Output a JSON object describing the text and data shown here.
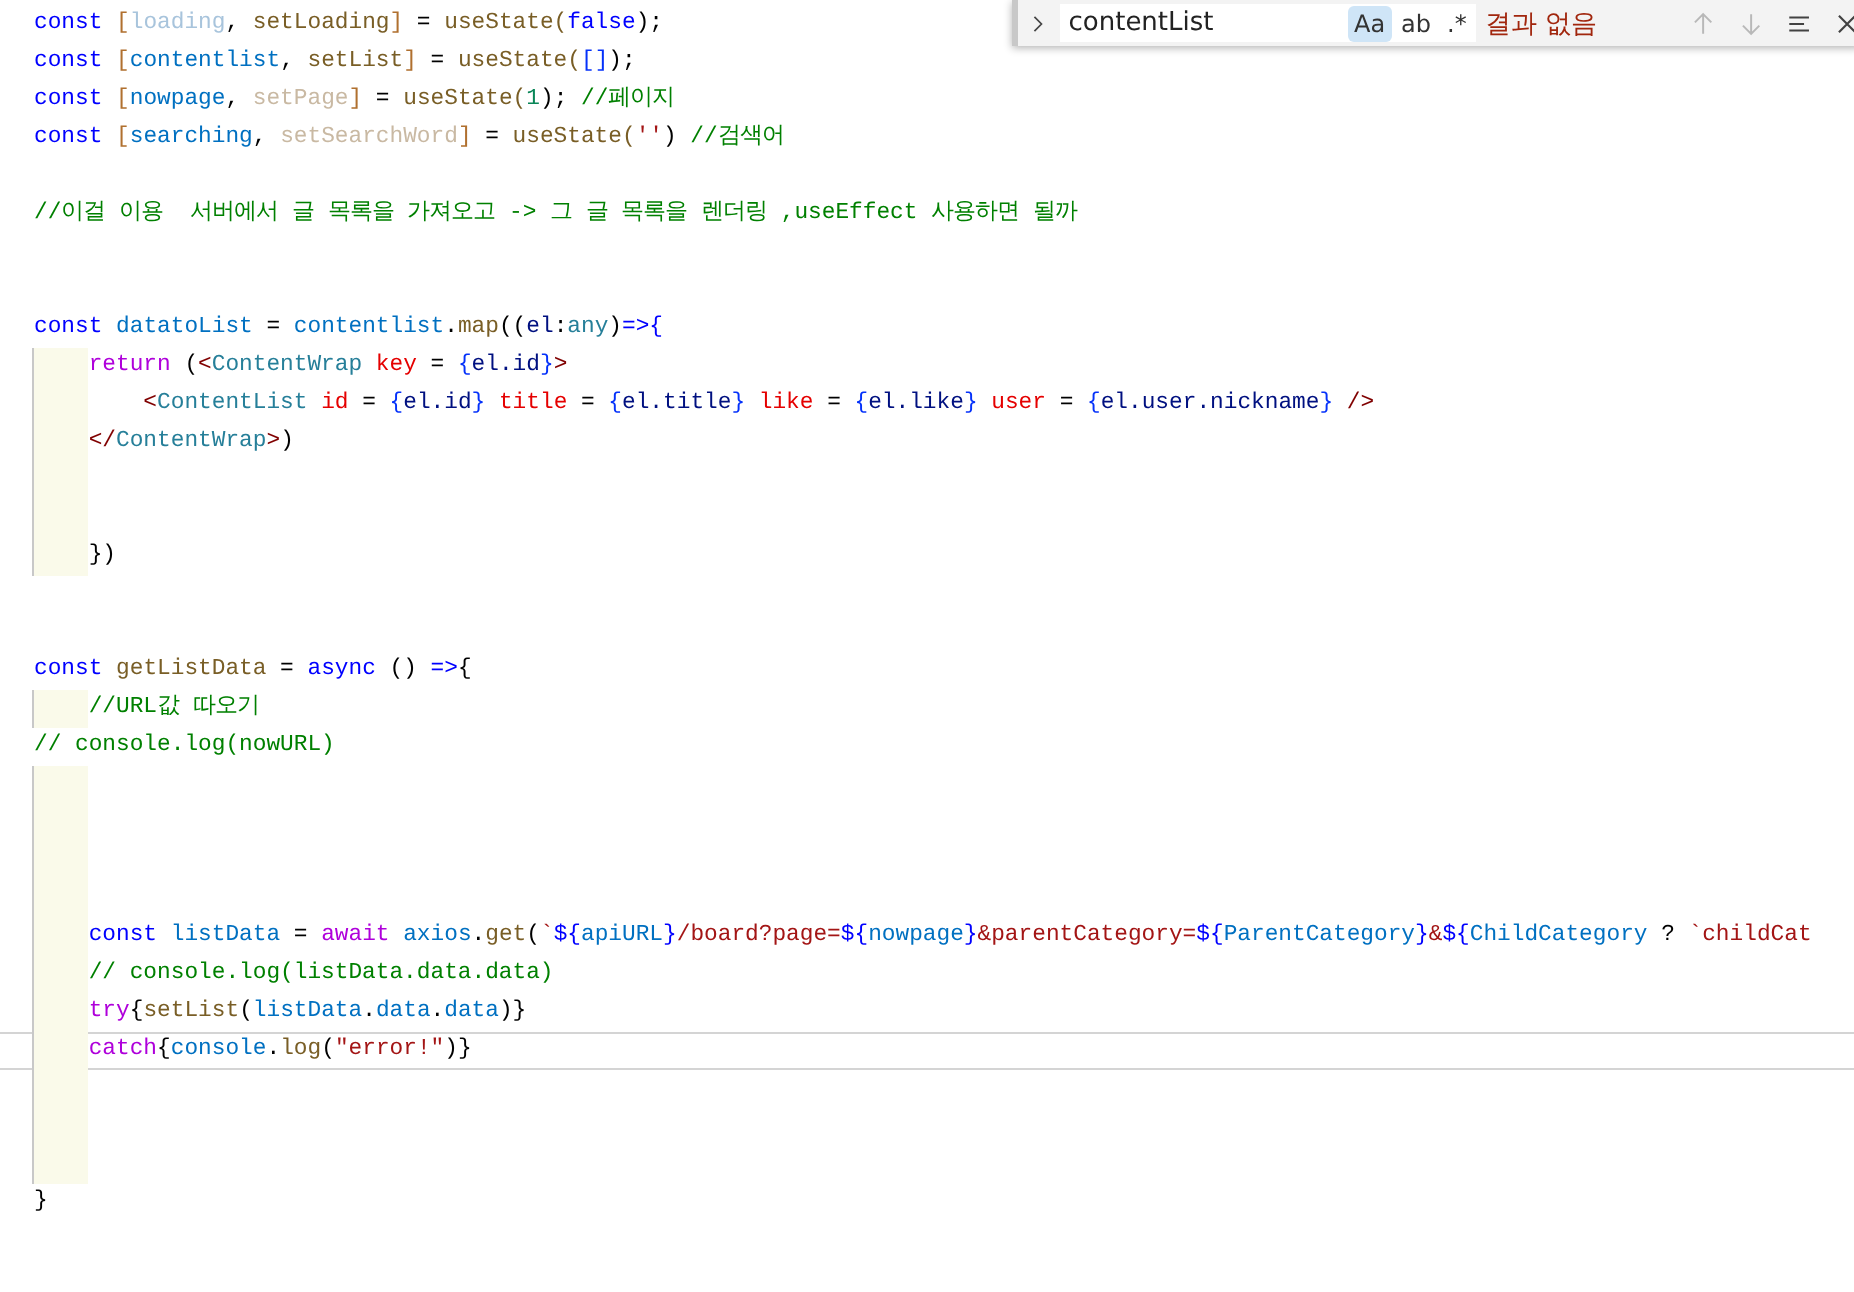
{
  "editor": {
    "lines": [
      {
        "current": false,
        "indented": false,
        "tokens": [
          {
            "text": "const",
            "kind": "keyword"
          },
          {
            "text": " [",
            "kind": "bracket"
          },
          {
            "text": "loading",
            "kind": "unused"
          },
          {
            "text": ", ",
            "kind": "plain"
          },
          {
            "text": "setLoading",
            "kind": "function"
          },
          {
            "text": "]",
            "kind": "bracket"
          },
          {
            "text": " = ",
            "kind": "plain"
          },
          {
            "text": "useState(",
            "kind": "function"
          },
          {
            "text": "false",
            "kind": "keyword"
          },
          {
            "text": ");",
            "kind": "plain"
          }
        ]
      },
      {
        "current": false,
        "indented": false,
        "tokens": [
          {
            "text": "const",
            "kind": "keyword"
          },
          {
            "text": " [",
            "kind": "bracket"
          },
          {
            "text": "contentlist",
            "kind": "variable"
          },
          {
            "text": ", ",
            "kind": "plain"
          },
          {
            "text": "setList",
            "kind": "function"
          },
          {
            "text": "]",
            "kind": "bracket"
          },
          {
            "text": " = ",
            "kind": "plain"
          },
          {
            "text": "useState(",
            "kind": "function"
          },
          {
            "text": "[]",
            "kind": "brace"
          },
          {
            "text": ");",
            "kind": "plain"
          }
        ]
      },
      {
        "current": false,
        "indented": false,
        "tokens": [
          {
            "text": "const",
            "kind": "keyword"
          },
          {
            "text": " [",
            "kind": "bracket"
          },
          {
            "text": "nowpage",
            "kind": "variable"
          },
          {
            "text": ", ",
            "kind": "plain"
          },
          {
            "text": "setPage",
            "kind": "unusedfn"
          },
          {
            "text": "]",
            "kind": "bracket"
          },
          {
            "text": " = ",
            "kind": "plain"
          },
          {
            "text": "useState(",
            "kind": "function"
          },
          {
            "text": "1",
            "kind": "number"
          },
          {
            "text": "); ",
            "kind": "plain"
          },
          {
            "text": "//페이지",
            "kind": "comment"
          }
        ]
      },
      {
        "current": false,
        "indented": false,
        "tokens": [
          {
            "text": "const",
            "kind": "keyword"
          },
          {
            "text": " [",
            "kind": "bracket"
          },
          {
            "text": "searching",
            "kind": "variable"
          },
          {
            "text": ", ",
            "kind": "plain"
          },
          {
            "text": "setSearchWord",
            "kind": "unusedfn"
          },
          {
            "text": "]",
            "kind": "bracket"
          },
          {
            "text": " = ",
            "kind": "plain"
          },
          {
            "text": "useState(",
            "kind": "function"
          },
          {
            "text": "''",
            "kind": "string"
          },
          {
            "text": ") ",
            "kind": "plain"
          },
          {
            "text": "//검색어",
            "kind": "comment"
          }
        ]
      },
      {
        "current": false,
        "indented": false
      },
      {
        "current": false,
        "indented": false,
        "tokens": [
          {
            "text": "//이걸 이용  서버에서 글 목록을 가져오고 -> 그 글 목록을 렌더링 ,useEffect 사용하면 될까",
            "kind": "comment"
          }
        ]
      },
      {
        "current": false,
        "indented": false
      },
      {
        "current": false,
        "indented": false
      },
      {
        "current": false,
        "indented": false,
        "tokens": [
          {
            "text": "const",
            "kind": "keyword"
          },
          {
            "text": " datatoList",
            "kind": "variable"
          },
          {
            "text": " = ",
            "kind": "plain"
          },
          {
            "text": "contentlist",
            "kind": "variable"
          },
          {
            "text": ".",
            "kind": "plain"
          },
          {
            "text": "map",
            "kind": "function"
          },
          {
            "text": "((",
            "kind": "plain"
          },
          {
            "text": "el",
            "kind": "property"
          },
          {
            "text": ":",
            "kind": "plain"
          },
          {
            "text": "any",
            "kind": "type"
          },
          {
            "text": ")",
            "kind": "plain"
          },
          {
            "text": "=>{",
            "kind": "keyword"
          }
        ]
      },
      {
        "current": false,
        "indented": true,
        "tokens": [
          {
            "text": "    return",
            "kind": "control"
          },
          {
            "text": " (",
            "kind": "plain"
          },
          {
            "text": "<",
            "kind": "tag"
          },
          {
            "text": "ContentWrap",
            "kind": "type"
          },
          {
            "text": " key",
            "kind": "attribute"
          },
          {
            "text": " = ",
            "kind": "plain"
          },
          {
            "text": "{",
            "kind": "brace"
          },
          {
            "text": "el.id",
            "kind": "property"
          },
          {
            "text": "}",
            "kind": "brace"
          },
          {
            "text": ">",
            "kind": "tag"
          }
        ]
      },
      {
        "current": false,
        "indented": true,
        "tokens": [
          {
            "text": "        <",
            "kind": "tag"
          },
          {
            "text": "ContentList",
            "kind": "type"
          },
          {
            "text": " id",
            "kind": "attribute"
          },
          {
            "text": " = ",
            "kind": "plain"
          },
          {
            "text": "{",
            "kind": "brace"
          },
          {
            "text": "el.id",
            "kind": "property"
          },
          {
            "text": "}",
            "kind": "brace"
          },
          {
            "text": " title",
            "kind": "attribute"
          },
          {
            "text": " = ",
            "kind": "plain"
          },
          {
            "text": "{",
            "kind": "brace"
          },
          {
            "text": "el.title",
            "kind": "property"
          },
          {
            "text": "}",
            "kind": "brace"
          },
          {
            "text": " like",
            "kind": "attribute"
          },
          {
            "text": " = ",
            "kind": "plain"
          },
          {
            "text": "{",
            "kind": "brace"
          },
          {
            "text": "el.like",
            "kind": "property"
          },
          {
            "text": "}",
            "kind": "brace"
          },
          {
            "text": " user",
            "kind": "attribute"
          },
          {
            "text": " = ",
            "kind": "plain"
          },
          {
            "text": "{",
            "kind": "brace"
          },
          {
            "text": "el.user.nickname",
            "kind": "property"
          },
          {
            "text": "}",
            "kind": "brace"
          },
          {
            "text": " />",
            "kind": "tag"
          }
        ]
      },
      {
        "current": false,
        "indented": true,
        "tokens": [
          {
            "text": "    </",
            "kind": "tag"
          },
          {
            "text": "ContentWrap",
            "kind": "type"
          },
          {
            "text": ">",
            "kind": "tag"
          },
          {
            "text": ")",
            "kind": "plain"
          }
        ]
      },
      {
        "current": false,
        "indented": true
      },
      {
        "current": false,
        "indented": true
      },
      {
        "current": false,
        "indented": true,
        "tokens": [
          {
            "text": "    })",
            "kind": "plain"
          }
        ]
      },
      {
        "current": false,
        "indented": false
      },
      {
        "current": false,
        "indented": false
      },
      {
        "current": false,
        "indented": false,
        "tokens": [
          {
            "text": "const",
            "kind": "keyword"
          },
          {
            "text": " getListData",
            "kind": "function"
          },
          {
            "text": " = ",
            "kind": "plain"
          },
          {
            "text": "async",
            "kind": "keyword"
          },
          {
            "text": " () ",
            "kind": "plain"
          },
          {
            "text": "=>",
            "kind": "keyword"
          },
          {
            "text": "{",
            "kind": "plain"
          }
        ]
      },
      {
        "current": false,
        "indented": true,
        "tokens": [
          {
            "text": "    //URL값 따오기",
            "kind": "comment"
          }
        ]
      },
      {
        "current": false,
        "indented": false,
        "tokens": [
          {
            "text": "// console.log(nowURL)",
            "kind": "comment"
          }
        ]
      },
      {
        "current": false,
        "indented": true
      },
      {
        "current": false,
        "indented": true
      },
      {
        "current": false,
        "indented": true
      },
      {
        "current": false,
        "indented": true
      },
      {
        "current": false,
        "indented": true,
        "tokens": [
          {
            "text": "    const",
            "kind": "keyword"
          },
          {
            "text": " listData",
            "kind": "variable"
          },
          {
            "text": " = ",
            "kind": "plain"
          },
          {
            "text": "await",
            "kind": "control"
          },
          {
            "text": " axios",
            "kind": "variable"
          },
          {
            "text": ".",
            "kind": "plain"
          },
          {
            "text": "get",
            "kind": "function"
          },
          {
            "text": "(",
            "kind": "plain"
          },
          {
            "text": "`",
            "kind": "string"
          },
          {
            "text": "${",
            "kind": "keyword"
          },
          {
            "text": "apiURL",
            "kind": "variable"
          },
          {
            "text": "}",
            "kind": "keyword"
          },
          {
            "text": "/board?page=",
            "kind": "string"
          },
          {
            "text": "${",
            "kind": "keyword"
          },
          {
            "text": "nowpage",
            "kind": "variable"
          },
          {
            "text": "}",
            "kind": "keyword"
          },
          {
            "text": "&parentCategory=",
            "kind": "string"
          },
          {
            "text": "${",
            "kind": "keyword"
          },
          {
            "text": "ParentCategory",
            "kind": "variable"
          },
          {
            "text": "}",
            "kind": "keyword"
          },
          {
            "text": "&",
            "kind": "string"
          },
          {
            "text": "${",
            "kind": "keyword"
          },
          {
            "text": "ChildCategory",
            "kind": "variable"
          },
          {
            "text": " ? ",
            "kind": "plain"
          },
          {
            "text": "`childCat",
            "kind": "string"
          }
        ]
      },
      {
        "current": false,
        "indented": true,
        "tokens": [
          {
            "text": "    // console.log(listData.data.data)",
            "kind": "comment"
          }
        ]
      },
      {
        "current": false,
        "indented": true,
        "tokens": [
          {
            "text": "    try",
            "kind": "control"
          },
          {
            "text": "{",
            "kind": "plain"
          },
          {
            "text": "setList",
            "kind": "function"
          },
          {
            "text": "(",
            "kind": "plain"
          },
          {
            "text": "listData",
            "kind": "variable"
          },
          {
            "text": ".",
            "kind": "plain"
          },
          {
            "text": "data",
            "kind": "variable"
          },
          {
            "text": ".",
            "kind": "plain"
          },
          {
            "text": "data",
            "kind": "variable"
          },
          {
            "text": ")}",
            "kind": "plain"
          }
        ]
      },
      {
        "current": true,
        "indented": true,
        "tokens": [
          {
            "text": "    catch",
            "kind": "control"
          },
          {
            "text": "{",
            "kind": "plain"
          },
          {
            "text": "console",
            "kind": "variable"
          },
          {
            "text": ".",
            "kind": "plain"
          },
          {
            "text": "log",
            "kind": "function"
          },
          {
            "text": "(",
            "kind": "plain"
          },
          {
            "text": "\"error!\"",
            "kind": "string"
          },
          {
            "text": ")}",
            "kind": "plain"
          }
        ]
      },
      {
        "current": false,
        "indented": true
      },
      {
        "current": false,
        "indented": true
      },
      {
        "current": false,
        "indented": true
      },
      {
        "current": false,
        "indented": false,
        "tokens": [
          {
            "text": "}",
            "kind": "plain"
          }
        ]
      }
    ]
  },
  "find_widget": {
    "replace_expanded": false,
    "value": "contentList",
    "options": [
      {
        "label": "Aa",
        "selected": true
      },
      {
        "label": "ab",
        "selected": false
      },
      {
        "label": ".*",
        "selected": false
      }
    ],
    "result": "결과 없음",
    "buttons": [
      {
        "kind": "previous",
        "disabled": true
      },
      {
        "kind": "next",
        "disabled": true
      },
      {
        "kind": "selection",
        "disabled": false
      },
      {
        "kind": "close",
        "disabled": false
      }
    ]
  }
}
